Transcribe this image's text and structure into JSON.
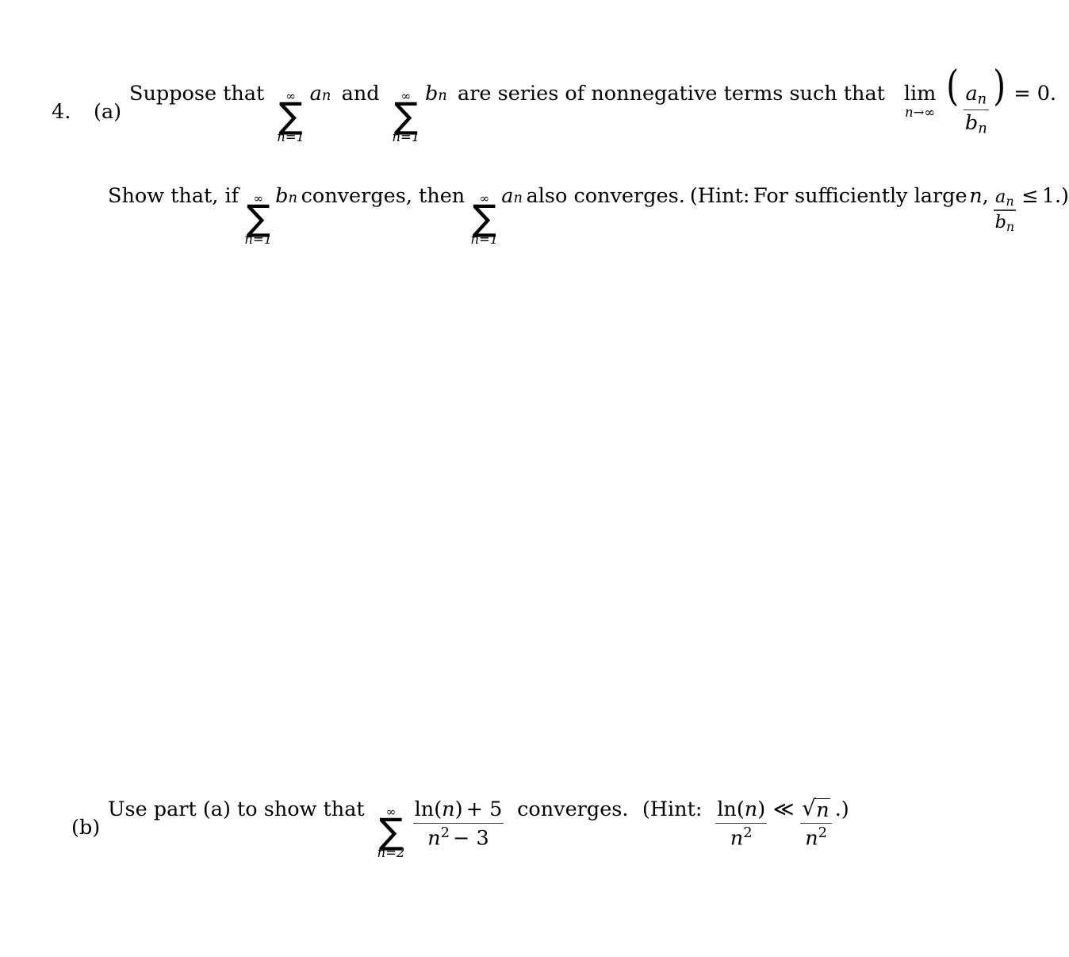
{
  "document": {
    "kind": "math-homework-problem",
    "background_color": "#ffffff",
    "text_color": "#000000"
  },
  "problem": {
    "number": "4.",
    "parts": [
      {
        "label": "(a)",
        "lines": [
          {
            "segments": [
              "Suppose that",
              "sum a_n",
              "and",
              "sum b_n",
              "are series of nonnegative terms such that",
              "lim n->infinity (a_n / b_n)",
              "= 0."
            ],
            "text_1": "Suppose that",
            "text_2": "and",
            "text_3": "are series of nonnegative terms such that",
            "text_4": "= 0."
          },
          {
            "text_1": "Show that, if",
            "text_2": "converges, then",
            "text_3": "also converges.",
            "text_4": "(Hint:",
            "text_5": "For sufficiently large",
            "text_6": "n",
            "text_7": ",",
            "text_8": "1.)"
          }
        ]
      },
      {
        "label": "(b)",
        "lines": [
          {
            "text_1": "Use part (a) to show that",
            "text_2": "converges.",
            "text_3": "(Hint:",
            "text_4": ".)"
          }
        ]
      }
    ]
  },
  "math": {
    "infinity": "∞",
    "sigma": "∑",
    "lim": "lim",
    "arrow_to_infinity": "n→∞",
    "lower_limit_n1": "n=1",
    "lower_limit_n2": "n=2",
    "a_n_numer": "a",
    "a_n_sub": "n",
    "b_n_denom": "b",
    "b_n_sub": "n",
    "equals_zero": "= 0.",
    "leq": "≤",
    "one": "1.)",
    "much_less_than": "≪",
    "radical_sign": "√",
    "paren_left_big": "(",
    "paren_right_big": ")",
    "ln_of_n": "ln(",
    "ln_close": ")",
    "plus_five": "+ 5",
    "n_squared": "n",
    "exp_two": "2",
    "minus_three": "− 3",
    "var_n": "n",
    "var_a": "a",
    "var_b": "b"
  }
}
